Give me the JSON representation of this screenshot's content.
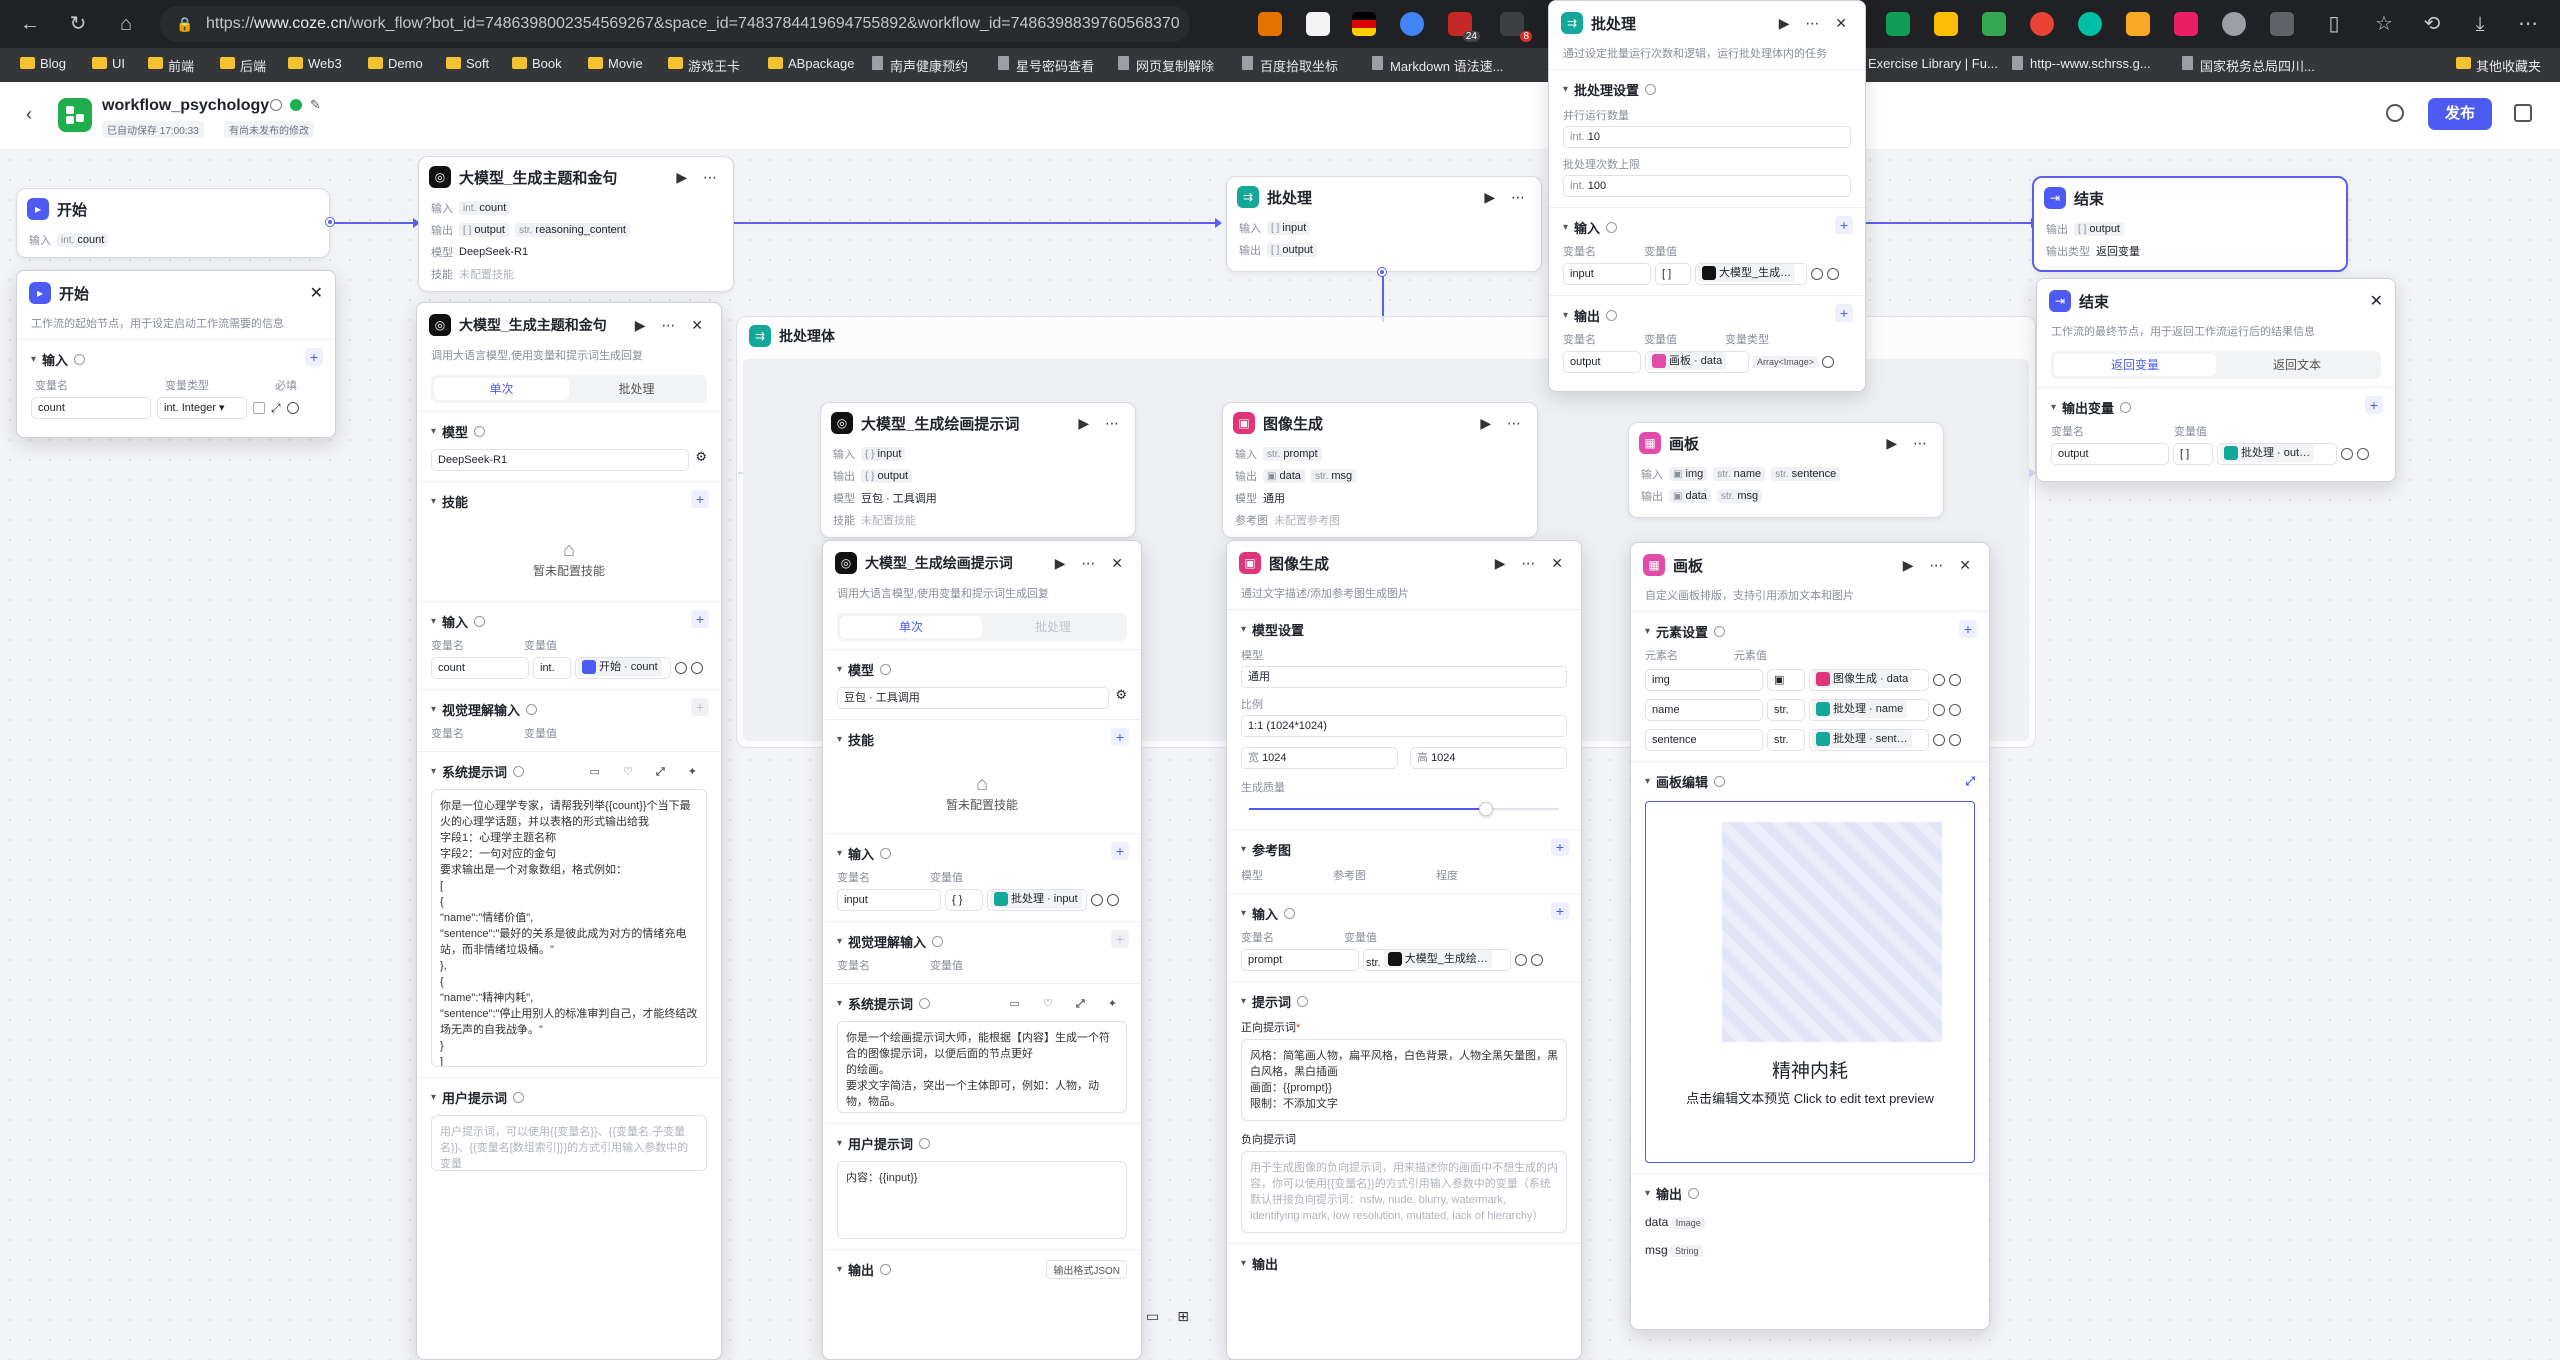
{
  "browser": {
    "url_prefix": "https://",
    "url_host": "www.coze.cn",
    "url_path": "/work_flow?bot_id=7486398002354569267&space_id=7483784419694755892&workflow_id=7486398839760568370",
    "bookmarks": [
      "Blog",
      "UI",
      "前端",
      "后端",
      "Web3",
      "Demo",
      "Soft",
      "Book",
      "Movie",
      "游戏王卡",
      "ABpackage",
      "南声健康预约",
      "星号密码查看",
      "网页复制解除",
      "百度拾取坐标",
      "Markdown 语法速...",
      "Exercise Library | Fu...",
      "http--www.schrss.g...",
      "国家税务总局四川...",
      "其他收藏夹"
    ],
    "ext_badges": [
      "24",
      "8"
    ]
  },
  "app": {
    "title": "workflow_psychology",
    "autosave": "已自动保存 17:00:33",
    "unpublished": "有尚未发布的修改",
    "publish": "发布"
  },
  "nodes": {
    "start": {
      "title": "开始",
      "in_label": "输入",
      "var": "count",
      "type": "int."
    },
    "llm1": {
      "title": "大模型_生成主题和金句",
      "in_label": "输入",
      "in_var": "count",
      "out_label": "输出",
      "out1": "output",
      "out2": "reasoning_content",
      "model_label": "模型",
      "model": "DeepSeek-R1",
      "skill_label": "技能",
      "skill": "未配置技能"
    },
    "batch": {
      "title": "批处理",
      "in_label": "输入",
      "in_var": "input",
      "out_label": "输出",
      "out_var": "output"
    },
    "end": {
      "title": "结束",
      "out_label": "输出",
      "out_var": "output",
      "out_type_label": "输出类型",
      "out_type": "返回变量"
    },
    "batch_body": {
      "title": "批处理体"
    },
    "llm2": {
      "title": "大模型_生成绘画提示词",
      "in_label": "输入",
      "in_var": "input",
      "out_label": "输出",
      "out_var": "output",
      "model_label": "模型",
      "model": "豆包 · 工具调用",
      "skill_label": "技能",
      "skill": "未配置技能"
    },
    "img": {
      "title": "图像生成",
      "in_label": "输入",
      "in_var": "prompt",
      "out_label": "输出",
      "out1": "data",
      "out2": "msg",
      "model_label": "模型",
      "model": "通用",
      "ref_label": "参考图",
      "ref": "未配置参考图"
    },
    "canvas": {
      "title": "画板",
      "in_label": "输入",
      "in1": "img",
      "in2": "name",
      "in3": "sentence",
      "out_label": "输出",
      "out1": "data",
      "out2": "msg"
    }
  },
  "panels": {
    "start": {
      "title": "开始",
      "desc": "工作流的起始节点，用于设定启动工作流需要的信息",
      "section": "输入",
      "h_name": "变量名",
      "h_type": "变量类型",
      "h_req": "必填",
      "var": "count",
      "type": "Integer"
    },
    "llm1": {
      "title": "大模型_生成主题和金句",
      "desc": "调用大语言模型,使用变量和提示词生成回复",
      "tab1": "单次",
      "tab2": "批处理",
      "model_sec": "模型",
      "model": "DeepSeek-R1",
      "skill_sec": "技能",
      "skill_empty": "暂未配置技能",
      "input_sec": "输入",
      "h_name": "变量名",
      "h_value": "变量值",
      "var": "count",
      "var_type": "int.",
      "ref": "开始 · count",
      "vision_sec": "视觉理解输入",
      "sys_sec": "系统提示词",
      "sys_text": "你是一位心理学专家，请帮我列举{{count}}个当下最火的心理学话题，并以表格的形式输出给我\n字段1：心理学主题名称\n字段2：一句对应的金句\n要求输出是一个对象数组，格式例如：\n[\n{\n\"name\":\"情绪价值\",\n\"sentence\":\"最好的关系是彼此成为对方的情绪充电站，而非情绪垃圾桶。\"\n},\n{\n\"name\":\"精神内耗\",\n\"sentence\":\"停止用别人的标准审判自己，才能终结改场无声的自我战争。\"\n}\n]",
      "user_sec": "用户提示词",
      "user_ph": "用户提示词，可以使用{{变量名}}、{{变量名.子变量名}}、{{变量名[数组索引]}}的方式引用输入参数中的变量"
    },
    "llm2": {
      "title": "大模型_生成绘画提示词",
      "desc": "调用大语言模型,使用变量和提示词生成回复",
      "tab1": "单次",
      "tab2": "批处理",
      "model_sec": "模型",
      "model": "豆包 · 工具调用",
      "skill_sec": "技能",
      "skill_empty": "暂未配置技能",
      "input_sec": "输入",
      "h_name": "变量名",
      "h_value": "变量值",
      "var": "input",
      "var_type": "{ }",
      "ref": "批处理 · input",
      "vision_sec": "视觉理解输入",
      "sys_sec": "系统提示词",
      "sys_text": "你是一个绘画提示词大师，能根据【内容】生成一个符合的图像提示词，以便后面的节点更好\n的绘画。\n要求文字简洁，突出一个主体即可，例如：人物，动物，物品。",
      "user_sec": "用户提示词",
      "user_text": "内容：{{input}}",
      "output_sec": "输出",
      "output_fmt": "输出格式JSON"
    },
    "img": {
      "title": "图像生成",
      "desc": "通过文字描述/添加参考图生成图片",
      "model_sec": "模型设置",
      "model_label": "模型",
      "model": "通用",
      "ratio_label": "比例",
      "ratio": "1:1 (1024*1024)",
      "w_label": "宽",
      "w": "1024",
      "h_label": "高",
      "h": "1024",
      "quality_label": "生成质量",
      "quality": 0.76,
      "ref_sec": "参考图",
      "ref_h1": "模型",
      "ref_h2": "参考图",
      "ref_h3": "程度",
      "input_sec": "输入",
      "h_name": "变量名",
      "h_value": "变量值",
      "var": "prompt",
      "var_type": "str.",
      "ref": "大模型_生成绘…",
      "prompt_sec": "提示词",
      "pos_label": "正向提示词",
      "pos_text": "风格：简笔画人物，扁平风格，白色背景，人物全黑矢量图，黑白风格，黑白插画\n画面：{{prompt}}\n限制：不添加文字",
      "neg_label": "负向提示词",
      "neg_ph": "用于生成图像的负向提示词，用来描述你的画面中不想生成的内容，你可以使用{{变量名}}的方式引用输入参数中的变量（系统默认拼接负向提示词：nsfw, nude, blurry, watermark, identifying mark, low resolution, mutated, lack of hierarchy）",
      "output_sec": "输出"
    },
    "canvas": {
      "title": "画板",
      "desc": "自定义画板排版，支持引用添加文本和图片",
      "elem_sec": "元素设置",
      "h_name": "元素名",
      "h_value": "元素值",
      "items": [
        {
          "name": "img",
          "type": "▣",
          "ref": "图像生成 · data"
        },
        {
          "name": "name",
          "type": "str.",
          "ref": "批处理 · name"
        },
        {
          "name": "sentence",
          "type": "str.",
          "ref": "批处理 · sent…"
        }
      ],
      "edit_sec": "画板编辑",
      "preview_title": "精神内耗",
      "preview_sub": "点击编辑文本预览 Click to edit text preview",
      "output_sec": "输出",
      "out1": "data",
      "out1_type": "Image",
      "out2": "msg",
      "out2_type": "String"
    },
    "batch": {
      "title": "批处理",
      "desc": "通过设定批量运行次数和逻辑，运行批处理体内的任务",
      "set_sec": "批处理设置",
      "par_label": "并行运行数量",
      "par": "10",
      "max_label": "批处理次数上限",
      "max": "100",
      "type": "int.",
      "input_sec": "输入",
      "h_name": "变量名",
      "h_value": "变量值",
      "in_var": "input",
      "in_type": "[ ]",
      "in_ref": "大模型_生成…",
      "output_sec": "输出",
      "h_type": "变量类型",
      "out_var": "output",
      "out_ref": "画板 · data",
      "out_type": "Array<Image>"
    },
    "end": {
      "title": "结束",
      "desc": "工作流的最终节点，用于返回工作流运行后的结果信息",
      "tab1": "返回变量",
      "tab2": "返回文本",
      "out_sec": "输出变量",
      "h_name": "变量名",
      "h_value": "变量值",
      "var": "output",
      "var_type": "[ ]",
      "ref": "批处理 · out…"
    }
  },
  "colors": {
    "accent": "#4e5bf2",
    "start": "#4e5bf2",
    "llm": "#1f2329",
    "batch": "#14a89a",
    "img": "#e0357a",
    "canvas": "#e24ba9",
    "end": "#4e5bf2"
  }
}
